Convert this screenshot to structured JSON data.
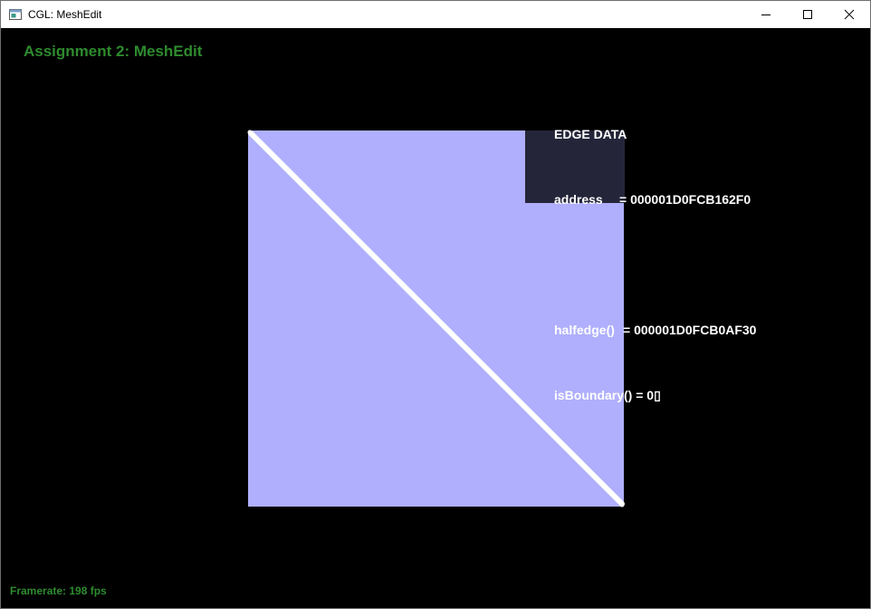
{
  "window": {
    "title": "CGL: MeshEdit",
    "controls": {
      "minimize": "minimize-icon",
      "maximize": "maximize-icon",
      "close": "close-icon"
    }
  },
  "app": {
    "title": "Assignment 2: MeshEdit",
    "framerate": "Framerate: 198 fps",
    "accent_color": "#2e8b2e"
  },
  "mesh": {
    "face_color": "#afaffd",
    "selected_edge_color": "#ffffff"
  },
  "edge_data": {
    "heading": "EDGE DATA",
    "address_label": "address",
    "address_value": "= 000001D0FCB162F0",
    "halfedge_label": "halfedge()",
    "halfedge_value": "= 000001D0FCB0AF30",
    "boundary_label": "isBoundary()",
    "boundary_value": "= 0▯"
  }
}
